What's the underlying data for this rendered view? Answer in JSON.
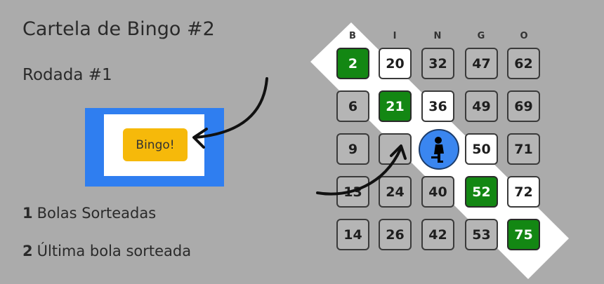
{
  "title": "Cartela de Bingo #2",
  "round": "Rodada #1",
  "bingo_button": "Bingo!",
  "stats": [
    {
      "num": "1",
      "label": "Bolas Sorteadas"
    },
    {
      "num": "2",
      "label": "Última bola sorteada"
    }
  ],
  "card": {
    "letters": [
      "B",
      "I",
      "N",
      "G",
      "O"
    ],
    "rows": [
      [
        "2",
        "20",
        "32",
        "47",
        "62"
      ],
      [
        "6",
        "21",
        "36",
        "49",
        "69"
      ],
      [
        "9",
        "",
        "FREE",
        "50",
        "71"
      ],
      [
        "13",
        "24",
        "40",
        "52",
        "72"
      ],
      [
        "14",
        "26",
        "42",
        "53",
        "75"
      ]
    ],
    "marked": [
      "2",
      "21",
      "52",
      "75"
    ],
    "free_icon": "person-icon"
  },
  "colors": {
    "background": "#ababab",
    "accent_blue": "#2f7ef0",
    "button_yellow": "#f6b90a",
    "marked_green": "#138713"
  }
}
